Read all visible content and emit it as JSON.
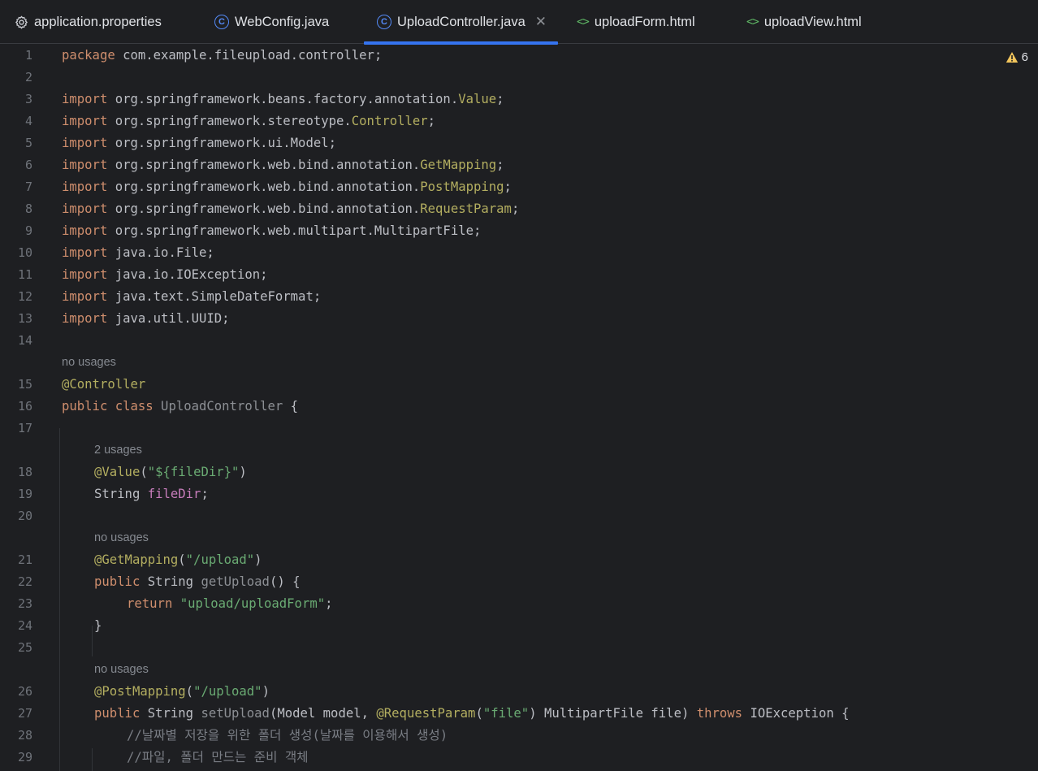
{
  "tabs": [
    {
      "label": "application.properties",
      "icon": "gear-icon",
      "active": false
    },
    {
      "label": "WebConfig.java",
      "icon": "class-icon",
      "active": false
    },
    {
      "label": "UploadController.java",
      "icon": "class-icon",
      "active": true
    },
    {
      "label": "uploadForm.html",
      "icon": "html-icon",
      "active": false
    },
    {
      "label": "uploadView.html",
      "icon": "html-icon",
      "active": false
    }
  ],
  "editor": {
    "warning_count": "6",
    "hints": {
      "h15": "no usages",
      "h18": "2 usages",
      "h21": "no usages",
      "h26": "no usages"
    },
    "line_numbers": [
      "1",
      "2",
      "3",
      "4",
      "5",
      "6",
      "7",
      "8",
      "9",
      "10",
      "11",
      "12",
      "13",
      "14",
      "15",
      "16",
      "17",
      "18",
      "19",
      "20",
      "21",
      "22",
      "23",
      "24",
      "25",
      "26",
      "27",
      "28",
      "29"
    ],
    "code": {
      "l1a": "package",
      "l1b": " com.example.fileupload.controller;",
      "l3a": "import",
      "l3b": " org.springframework.beans.factory.annotation.",
      "l3c": "Value",
      "l3d": ";",
      "l4a": "import",
      "l4b": " org.springframework.stereotype.",
      "l4c": "Controller",
      "l4d": ";",
      "l5a": "import",
      "l5b": " org.springframework.ui.Model;",
      "l6a": "import",
      "l6b": " org.springframework.web.bind.annotation.",
      "l6c": "GetMapping",
      "l6d": ";",
      "l7a": "import",
      "l7b": " org.springframework.web.bind.annotation.",
      "l7c": "PostMapping",
      "l7d": ";",
      "l8a": "import",
      "l8b": " org.springframework.web.bind.annotation.",
      "l8c": "RequestParam",
      "l8d": ";",
      "l9a": "import",
      "l9b": " org.springframework.web.multipart.MultipartFile;",
      "l10a": "import",
      "l10b": " java.io.File;",
      "l11a": "import",
      "l11b": " java.io.IOException;",
      "l12a": "import",
      "l12b": " java.text.SimpleDateFormat;",
      "l13a": "import",
      "l13b": " java.util.UUID;",
      "l15a": "@Controller",
      "l16a": "public class",
      "l16b": " UploadController",
      "l16c": " {",
      "l18a": "@Value",
      "l18b": "(",
      "l18c": "\"${fileDir}\"",
      "l18d": ")",
      "l19a": "String ",
      "l19b": "fileDir",
      "l19c": ";",
      "l21a": "@GetMapping",
      "l21b": "(",
      "l21c": "\"/upload\"",
      "l21d": ")",
      "l22a": "public",
      "l22b": " String ",
      "l22c": "getUpload",
      "l22d": "() {",
      "l23a": "return",
      "l23b": " ",
      "l23c": "\"upload/uploadForm\"",
      "l23d": ";",
      "l24a": "}",
      "l26a": "@PostMapping",
      "l26b": "(",
      "l26c": "\"/upload\"",
      "l26d": ")",
      "l27a": "public",
      "l27b": " String ",
      "l27c": "setUpload",
      "l27d": "(Model model, ",
      "l27e": "@RequestParam",
      "l27f": "(",
      "l27g": "\"file\"",
      "l27h": ") MultipartFile file) ",
      "l27i": "throws",
      "l27j": " IOException {",
      "l28a": "//날짜별 저장을 위한 폴더 생성(날짜를 이용해서 생성)",
      "l29a": "//파일, 폴더 만드는 준비 객체"
    }
  }
}
